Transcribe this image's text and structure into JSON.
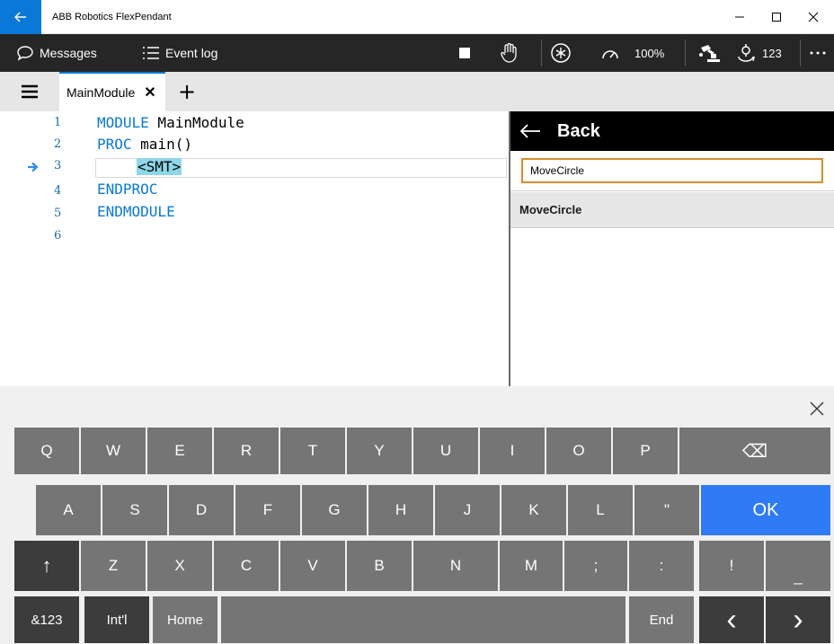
{
  "window": {
    "title": "ABB Robotics FlexPendant",
    "back_icon": "arrow-left-icon",
    "controls": [
      "minimize-icon",
      "maximize-icon",
      "close-icon"
    ]
  },
  "toolbar": {
    "messages_label": "Messages",
    "event_log_label": "Event log",
    "speed_label": "100%",
    "jog_label": "123",
    "icons": [
      "chat-icon",
      "list-icon",
      "stop-icon",
      "hand-icon",
      "motors-icon",
      "speedometer-icon",
      "robot-icon",
      "jog-icon",
      "more-icon"
    ],
    "colors": {
      "background": "#262626",
      "text": "#ffffff"
    }
  },
  "tabs": {
    "menu_icon": "hamburger-icon",
    "items": [
      {
        "label": "MainModule",
        "close": "✕"
      }
    ],
    "add_label": "+",
    "accent": "#0a78d7"
  },
  "editor": {
    "lines": [
      {
        "num": "1",
        "keyword": "MODULE",
        "rest": " MainModule"
      },
      {
        "num": "2",
        "keyword": "PROC",
        "rest": " main()"
      },
      {
        "num": "3",
        "keyword": "",
        "rest": "<SMT>"
      },
      {
        "num": "4",
        "keyword": "ENDPROC",
        "rest": ""
      },
      {
        "num": "5",
        "keyword": "ENDMODULE",
        "rest": ""
      },
      {
        "num": "6",
        "keyword": "",
        "rest": ""
      }
    ],
    "current_line": "3",
    "colors": {
      "keyword": "#0a78d7",
      "line_number": "#1d6c9e",
      "placeholder_highlight": "#8ed7e8",
      "program_pointer": "#2f8cf0"
    }
  },
  "panel": {
    "back_label": "Back",
    "search_value": "MoveCircle",
    "results": [
      "MoveCircle"
    ],
    "colors": {
      "search_border": "#d98c2b",
      "header": "#000000"
    }
  },
  "keyboard": {
    "row1": [
      "Q",
      "W",
      "E",
      "R",
      "T",
      "Y",
      "U",
      "I",
      "O",
      "P"
    ],
    "row2": [
      "A",
      "S",
      "D",
      "F",
      "G",
      "H",
      "J",
      "K",
      "L",
      "\""
    ],
    "row3": [
      "Z",
      "X",
      "C",
      "V",
      "B",
      "N",
      "M",
      ";",
      ":",
      "!",
      "_"
    ],
    "shift": "↑",
    "backspace": "⌫",
    "ok": "OK",
    "sym": "&123",
    "intl": "Int'l",
    "home": "Home",
    "end": "End",
    "prev": "‹",
    "next": "›",
    "close_icon": "close-icon",
    "colors": {
      "key": "#757575",
      "dark_key": "#3c3c3c",
      "ok": "#2f7bf5",
      "background": "#f0f0f0"
    }
  }
}
